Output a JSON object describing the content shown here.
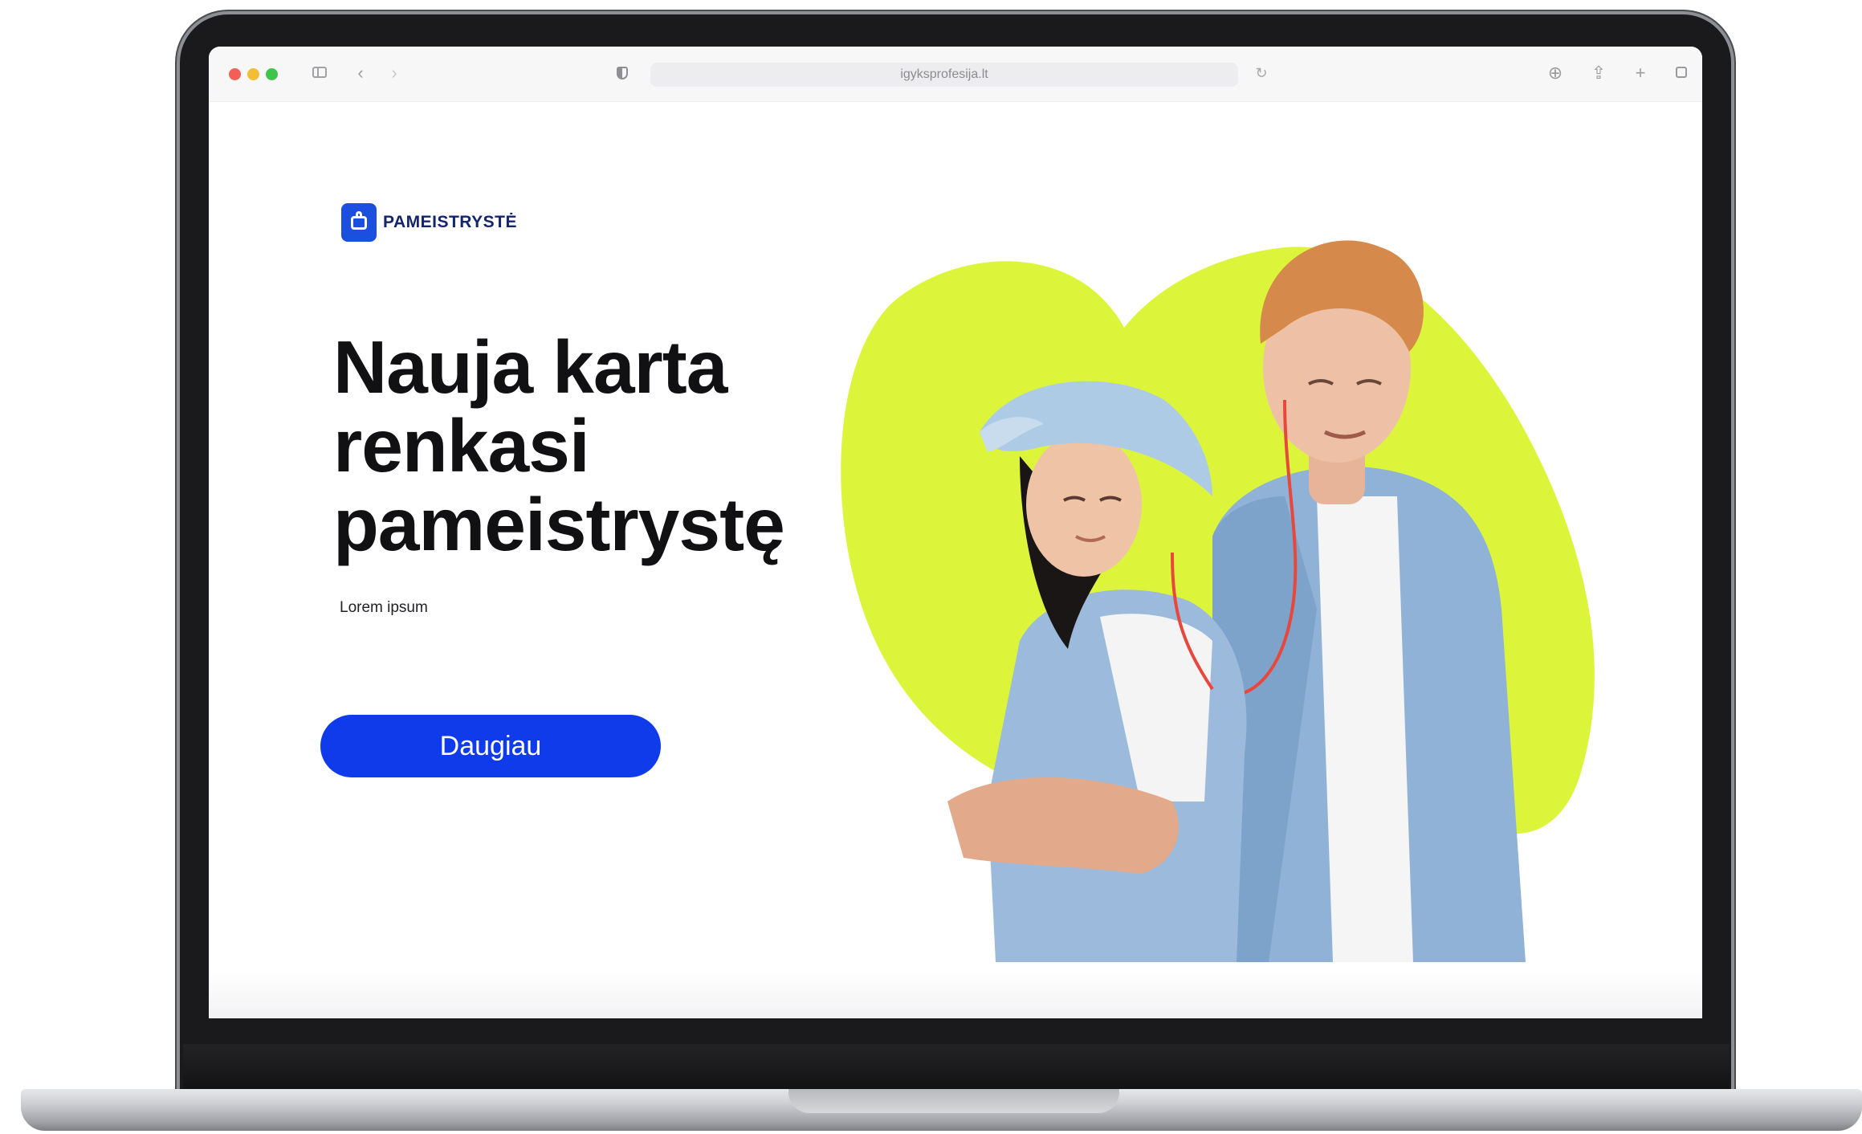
{
  "browser": {
    "url": "igyksprofesija.lt"
  },
  "brand": {
    "name": "PAMEISTRYSTĖ"
  },
  "hero": {
    "headline_line1": "Nauja karta",
    "headline_line2": "renkasi",
    "headline_line3": "pameistrystę",
    "subtitle": "Lorem ipsum",
    "cta_label": "Daugiau"
  },
  "colors": {
    "brand_blue": "#0f3bea",
    "accent_lime": "#dcf53a",
    "headline": "#111114"
  },
  "icons": [
    "sidebar-toggle-icon",
    "back-icon",
    "forward-icon",
    "privacy-shield-icon",
    "reload-icon",
    "download-icon",
    "share-icon",
    "new-tab-icon",
    "tab-overview-icon"
  ]
}
